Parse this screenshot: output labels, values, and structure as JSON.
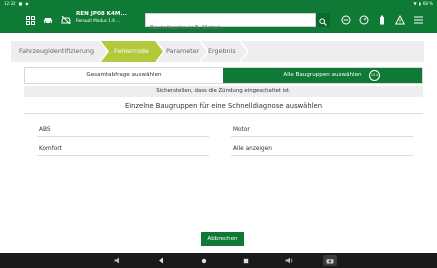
{
  "statusbar": {
    "time": "12:32",
    "battery": "68 %"
  },
  "vehicle": {
    "title": "REN JP08 K4M...",
    "subtitle": "Renault Modus 1.6 ..."
  },
  "search": {
    "placeholder": "Bauteilsuche (z.B. Motor)"
  },
  "wizard": {
    "steps": [
      {
        "label": "Fahrzeugidentifizierung",
        "active": false
      },
      {
        "label": "Fehlercode",
        "active": true
      },
      {
        "label": "Parameter",
        "active": false
      },
      {
        "label": "Ergebnis",
        "active": false
      }
    ]
  },
  "options": {
    "left_label": "Gesamtabfrage auswählen",
    "right_label": "Alle Baugruppen auswählen",
    "timer": "13 s"
  },
  "notice": "Sicherstellen, dass die Zündung eingeschaltet ist.",
  "heading": "Einzelne Baugruppen für eine Schnelldiagnose auswählen",
  "groups": [
    "ABS",
    "Motor",
    "Komfort",
    "Alle anzeigen"
  ],
  "buttons": {
    "abort": "Abbrechen"
  },
  "icons": {
    "appbar": [
      "grid-icon",
      "car-icon",
      "car-tools-icon",
      "search-icon",
      "minus-circle-icon",
      "gauge-icon",
      "battery-icon",
      "warning-icon",
      "menu-icon"
    ],
    "navbar": [
      "volume-down-icon",
      "back-icon",
      "home-icon",
      "recent-apps-icon",
      "volume-up-icon",
      "screenshot-icon"
    ]
  },
  "colors": {
    "primary": "#0f7a35",
    "step_active": "#b3c93b",
    "nav": "#1a1a1a"
  }
}
